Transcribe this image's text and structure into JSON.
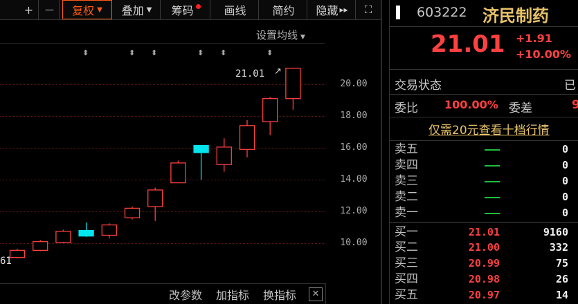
{
  "toolbar": {
    "plus": "+",
    "minus": "—",
    "fuquan": "复权",
    "diejia": "叠加",
    "chouma": "筹码",
    "huaxian": "画线",
    "jianyue": "简约",
    "yincang": "隐藏",
    "more": "▸▸",
    "expand": "⛶"
  },
  "chart": {
    "ma_settings": "设置均线",
    "last_price_label": "21.01",
    "left_label": "61",
    "y_ticks": [
      "20.00",
      "18.00",
      "16.00",
      "14.00",
      "12.00",
      "10.00"
    ],
    "bottom_buttons": {
      "gai_canshu": "改参数",
      "jia_zhibiao": "加指标",
      "huan_zhibiao": "换指标"
    }
  },
  "chart_data": {
    "type": "candlestick",
    "ylim": [
      9.5,
      21.0
    ],
    "candles": [
      {
        "open": 9.1,
        "close": 9.55,
        "high": 9.65,
        "low": 9.05,
        "color": "red"
      },
      {
        "open": 9.55,
        "close": 10.1,
        "high": 10.2,
        "low": 9.5,
        "color": "red"
      },
      {
        "open": 10.05,
        "close": 10.75,
        "high": 10.85,
        "low": 10.0,
        "color": "red"
      },
      {
        "open": 10.8,
        "close": 10.45,
        "high": 11.3,
        "low": 10.4,
        "color": "cyan"
      },
      {
        "open": 10.5,
        "close": 11.15,
        "high": 11.25,
        "low": 10.3,
        "color": "red"
      },
      {
        "open": 11.6,
        "close": 12.2,
        "high": 12.3,
        "low": 11.5,
        "color": "red"
      },
      {
        "open": 12.3,
        "close": 13.35,
        "high": 13.5,
        "low": 11.4,
        "color": "red"
      },
      {
        "open": 13.8,
        "close": 15.05,
        "high": 15.2,
        "low": 13.8,
        "color": "red"
      },
      {
        "open": 16.15,
        "close": 15.7,
        "high": 16.15,
        "low": 14.0,
        "color": "cyan"
      },
      {
        "open": 14.95,
        "close": 16.05,
        "high": 16.6,
        "low": 14.5,
        "color": "red"
      },
      {
        "open": 15.9,
        "close": 17.4,
        "high": 17.75,
        "low": 15.4,
        "color": "red"
      },
      {
        "open": 17.65,
        "close": 19.1,
        "high": 19.2,
        "low": 16.8,
        "color": "red"
      },
      {
        "open": 19.1,
        "close": 21.01,
        "high": 21.01,
        "low": 18.4,
        "color": "red"
      }
    ]
  },
  "quote": {
    "code": "603222",
    "name": "济民制药",
    "price": "21.01",
    "change": "+1.91",
    "change_pct": "+10.00%",
    "trade_status_label": "交易状态",
    "trade_status_value": "已",
    "weibi_label": "委比",
    "weibi_value": "100.00%",
    "weicha_label": "委差",
    "weicha_value": "9",
    "promo": "仅需20元查看十档行情"
  },
  "orderbook": {
    "asks": [
      {
        "label": "卖五",
        "volume": "0"
      },
      {
        "label": "卖四",
        "volume": "0"
      },
      {
        "label": "卖三",
        "volume": "0"
      },
      {
        "label": "卖二",
        "volume": "0"
      },
      {
        "label": "卖一",
        "volume": "0"
      }
    ],
    "bids": [
      {
        "label": "买一",
        "price": "21.01",
        "volume": "9160"
      },
      {
        "label": "买二",
        "price": "21.00",
        "volume": "332"
      },
      {
        "label": "买三",
        "price": "20.99",
        "volume": "75"
      },
      {
        "label": "买四",
        "price": "20.98",
        "volume": "26"
      },
      {
        "label": "买五",
        "price": "20.97",
        "volume": "14"
      }
    ]
  },
  "colors": {
    "up": "#ff4040",
    "down": "#00e5ee",
    "accent": "#ff5a14",
    "gold": "#e8c36a"
  }
}
